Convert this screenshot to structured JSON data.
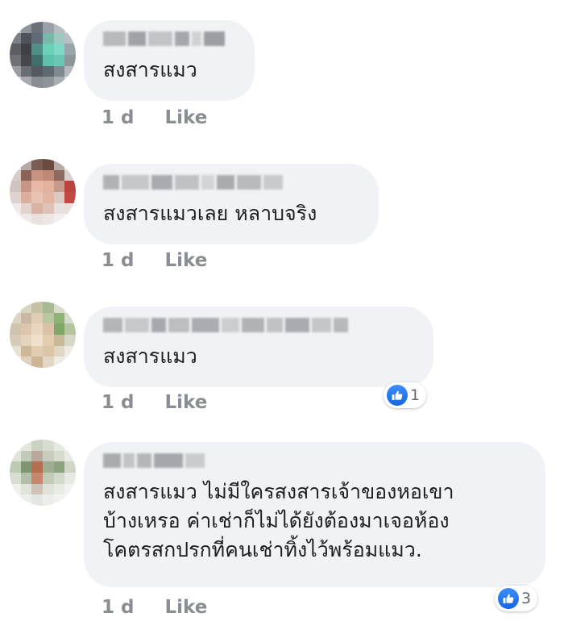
{
  "comments": [
    {
      "text": "สงสารแมว",
      "time": "1 d",
      "like_label": "Like",
      "reaction_count": null
    },
    {
      "text": "สงสารแมวเลย หลาบจริง",
      "time": "1 d",
      "like_label": "Like",
      "reaction_count": null
    },
    {
      "text": "สงสารแมว",
      "time": "1 d",
      "like_label": "Like",
      "reaction_count": "1"
    },
    {
      "text": "สงสารแมว ไม่มีใครสงสารเจ้าของหอเขา\nบ้างเหรอ ค่าเช่าก็ไม่ได้ยังต้องมาเจอห้อง\nโคตรสกปรกที่คนเช่าทิ้งไว้พร้อมแมว.",
      "time": "1 d",
      "like_label": "Like",
      "reaction_count": "3"
    }
  ],
  "reaction_icon": "thumbs-up-icon",
  "colors": {
    "bubble": "#f0f2f5",
    "text": "#1c1e21",
    "meta": "#8a8d91",
    "like_blue": "#1877f2"
  }
}
